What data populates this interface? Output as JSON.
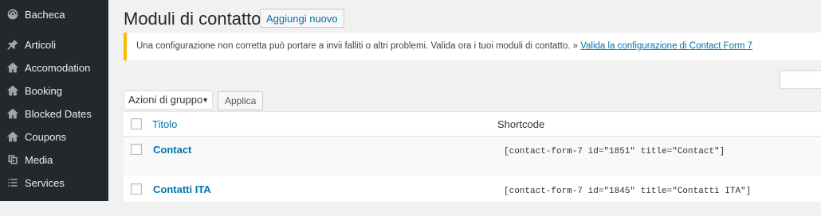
{
  "sidebar": {
    "items": [
      {
        "label": "Bacheca",
        "icon": "dashboard-icon"
      },
      {
        "label": "Articoli",
        "icon": "pin-icon"
      },
      {
        "label": "Accomodation",
        "icon": "home-icon"
      },
      {
        "label": "Booking",
        "icon": "home-icon"
      },
      {
        "label": "Blocked Dates",
        "icon": "home-icon"
      },
      {
        "label": "Coupons",
        "icon": "home-icon"
      },
      {
        "label": "Media",
        "icon": "media-icon"
      },
      {
        "label": "Services",
        "icon": "list-icon"
      }
    ]
  },
  "header": {
    "title": "Moduli di contatto",
    "add_new_label": "Aggiungi nuovo"
  },
  "notice": {
    "text": "Una configurazione non corretta può portare a invii falliti o altri problemi. Valida ora i tuoi moduli di contatto. » ",
    "link_text": "Valida la configurazione di Contact Form 7"
  },
  "bulk_actions": {
    "selected": "Azioni di gruppo",
    "apply_label": "Applica"
  },
  "table": {
    "columns": {
      "title": "Titolo",
      "shortcode": "Shortcode"
    },
    "rows": [
      {
        "title": "Contact",
        "shortcode": "[contact-form-7 id=\"1851\" title=\"Contact\"]"
      },
      {
        "title": "Contatti ITA",
        "shortcode": "[contact-form-7 id=\"1845\" title=\"Contatti ITA\"]"
      }
    ]
  },
  "colors": {
    "sidebar_bg": "#23282d",
    "link": "#0073aa",
    "notice_border": "#ffb900"
  }
}
